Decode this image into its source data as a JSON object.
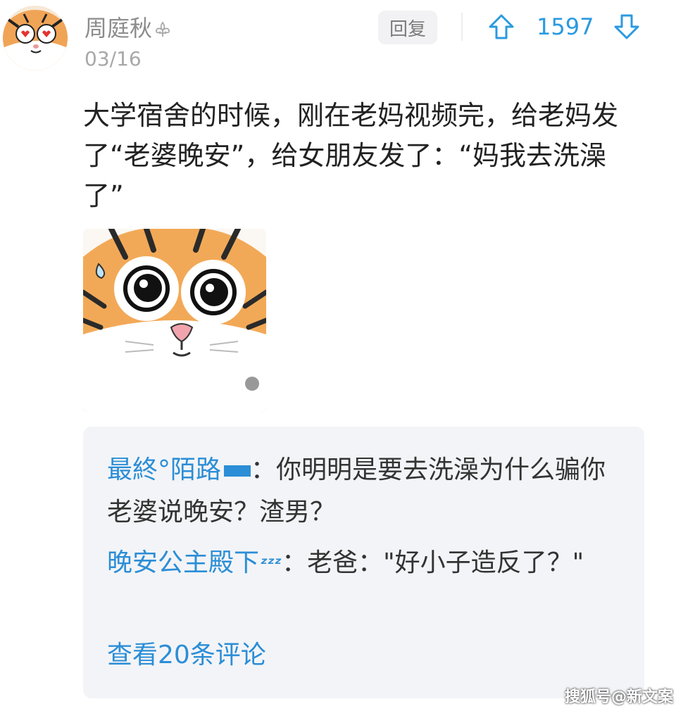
{
  "comment": {
    "username": "周庭秋",
    "badge_icon": "fleur-de-lis-icon",
    "date": "03/16",
    "reply_label": "回复",
    "vote_count": "1597",
    "upvote_icon": "arrow-up-icon",
    "downvote_icon": "arrow-down-icon",
    "text": "大学宿舍的时候，刚在老妈视频完，给老妈发了“老婆晚安”，给女朋友发了：“妈我去洗澡了”",
    "image_icon": "tiger-sticker-icon"
  },
  "replies": [
    {
      "author": "最終°陌路",
      "separator": "：",
      "text": "你明明是要去洗澡为什么骗你老婆说晚安？渣男？"
    },
    {
      "author": "晚安公主殿下",
      "separator": "：",
      "text": "老爸：\"好小子造反了？\""
    }
  ],
  "view_more_label": "查看20条评论",
  "watermark": "搜狐号@新文案",
  "colors": {
    "accent": "#2b8ed6",
    "vote": "#2b9ae0",
    "reply_bg": "#f3f4f7"
  }
}
